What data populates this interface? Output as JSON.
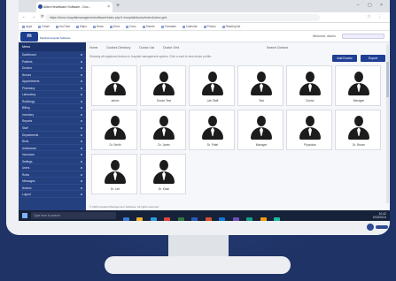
{
  "browser": {
    "tab_title": "Allied Healthcare Software - Doc...",
    "tab_close": "×",
    "new_tab": "+",
    "window_controls": "–  ▢  ×",
    "nav_controls": "← → ⟳",
    "url": "https://demo.hospitalmanagementsoftware/index.php?r=hospital/doctor/index&view=grid",
    "extensions": "☆ ⋮",
    "bookmarks": [
      "Apps",
      "Gmail",
      "YouTube",
      "Maps",
      "News",
      "Drive",
      "Docs",
      "Sheets",
      "Translate",
      "Calendar",
      "Photos",
      "Reading list"
    ]
  },
  "app": {
    "logo_mark": "m",
    "logo_text": "Medical Hospital Software",
    "header_right": "Welcome, Admin",
    "sidebar_title": "Menu",
    "sidebar_items": [
      "Dashboard",
      "Patients",
      "Doctors",
      "Nurses",
      "Appointments",
      "Pharmacy",
      "Laboratory",
      "Radiology",
      "Billing",
      "Inventory",
      "Reports",
      "Staff",
      "Departments",
      "Beds",
      "Ambulance",
      "Insurance",
      "Settings",
      "Users",
      "Roles",
      "Messages",
      "Notices",
      "Logout"
    ],
    "top_tabs": [
      "Home",
      "Doctors Directory",
      "Doctor List",
      "Doctor Grid"
    ],
    "top_right": "Search Doctors",
    "subline": "Showing all registered doctors in hospital management system. Click a card to view doctor profile.",
    "btn_primary": "Add Doctor",
    "btn_secondary": "Export",
    "doctors": [
      "admin",
      "Doctor Test",
      "Lab Staff",
      "Test",
      "Doctor",
      "Manager",
      "Dr. Smith",
      "Dr. Jones",
      "Dr. Patel",
      "Manager",
      "Physician",
      "Dr. Brown",
      "Dr. Lee",
      "Dr. Khan"
    ],
    "footer": "© 2024 Hospital Management Software. All rights reserved."
  },
  "taskbar": {
    "search_placeholder": "Type here to search",
    "time": "10:42",
    "date": "5/18/2024"
  }
}
